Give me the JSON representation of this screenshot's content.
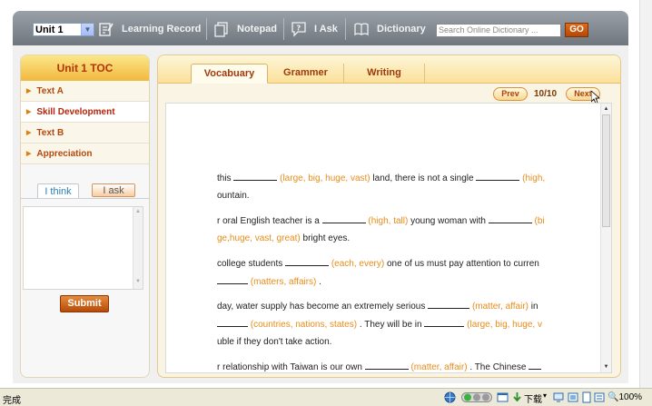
{
  "toolbar": {
    "unit_select_value": "Unit 1",
    "learning_record": "Learning Record",
    "notepad": "Notepad",
    "i_ask": "I Ask",
    "dictionary": "Dictionary",
    "search_placeholder": "Search  Online Dictionary ...",
    "go_label": "GO"
  },
  "toc": {
    "title": "Unit 1 TOC",
    "items": [
      {
        "label": "Text A"
      },
      {
        "label": "Skill Development"
      },
      {
        "label": "Text B"
      },
      {
        "label": "Appreciation"
      }
    ],
    "tab_think": "I think",
    "tab_ask": "I ask",
    "submit_label": "Submit"
  },
  "panel": {
    "tabs": [
      "Vocabuary",
      "Grammer",
      "Writing"
    ],
    "prev_label": "Prev",
    "counter": "10/10",
    "next_label": "Next"
  },
  "questions": [
    {
      "pre": "this",
      "opt": "(large, big, huge, vast)",
      "mid": "land, there is not a single",
      "opt2": "(high,"
    },
    {
      "pre": "ountain."
    },
    {
      "pre": "r oral English teacher is a",
      "opt": "(high, tall)",
      "mid": "young woman with",
      "opt2": "(bi"
    },
    {
      "pre": "",
      "opt": "ge,huge, vast, great)",
      "mid": "bright eyes."
    },
    {
      "pre": "college students",
      "opt": "(each, every)",
      "mid": "one of us must pay attention to curren"
    },
    {
      "pre": "",
      "opt": "(matters, affairs)",
      "mid": "."
    },
    {
      "pre": "day, water supply has become an extremely serious",
      "opt": "(matter, affair)",
      "mid": "in"
    },
    {
      "pre": "",
      "opt": "(countries, nations, states)",
      "mid": ". They will be in",
      "opt2": "(large, big, huge, v"
    },
    {
      "pre": "uble if they don't take action."
    },
    {
      "pre": "r relationship with Taiwan is our own",
      "opt": "(matter, affair)",
      "mid": ". The Chinese"
    }
  ],
  "statusbar": {
    "status": "完成",
    "download": "下载",
    "zoom": "100%"
  },
  "colors": {
    "accent": "#b5330a",
    "option_orange": "#e88c1a",
    "toolbar_gray": "#7d848b"
  }
}
